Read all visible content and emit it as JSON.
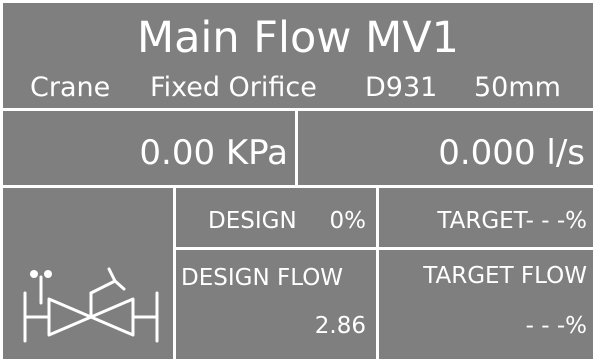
{
  "header": {
    "title": "Main Flow MV1",
    "subtitle": {
      "manufacturer": "Crane",
      "valve_type": "Fixed Orifice",
      "model": "D931",
      "size": "50mm"
    }
  },
  "readings": {
    "pressure": "0.00 KPa",
    "flow": "0.000 l/s"
  },
  "status": {
    "design_label": "DESIGN",
    "design_value": "0%",
    "target_text": "TARGET- - -%",
    "design_flow_label": "DESIGN FLOW",
    "design_flow_value": "2.86",
    "target_flow_label": "TARGET FLOW",
    "target_flow_value": "- - -%"
  },
  "icons": {
    "valve": "balancing-valve-icon"
  },
  "colors": {
    "panel_background": "#7f7f7f",
    "foreground": "#ffffff"
  }
}
